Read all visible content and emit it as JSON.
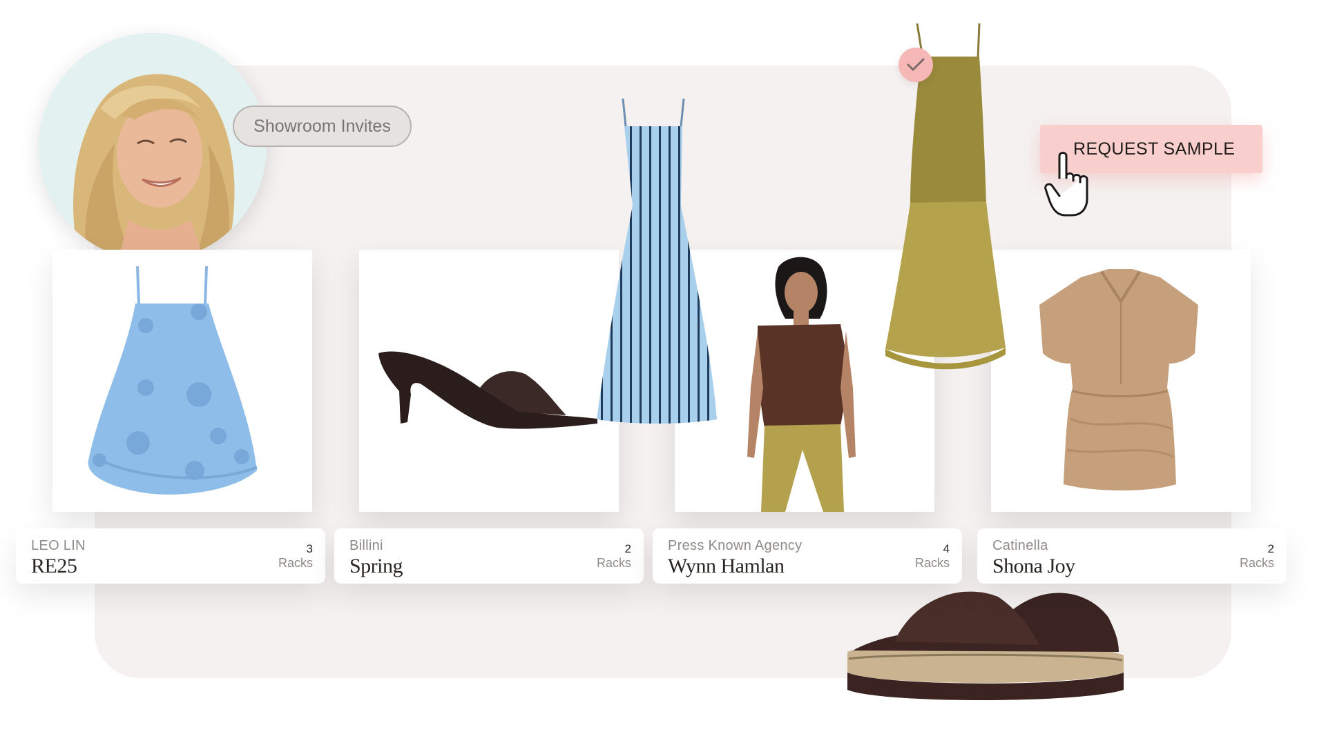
{
  "pill": {
    "label": "Showroom Invites"
  },
  "request": {
    "label": "REQUEST SAMPLE"
  },
  "cards": [
    {
      "brand": "LEO LIN",
      "collection": "RE25",
      "count": "3",
      "unit": "Racks"
    },
    {
      "brand": "Billini",
      "collection": "Spring",
      "count": "2",
      "unit": "Racks"
    },
    {
      "brand": "Press Known Agency",
      "collection": "Wynn Hamlan",
      "count": "4",
      "unit": "Racks"
    },
    {
      "brand": "Catinella",
      "collection": "Shona Joy",
      "count": "2",
      "unit": "Racks"
    }
  ],
  "colors": {
    "panel": "#f4f1f0",
    "accent_pink": "#f9cfcd",
    "check_pink": "#f6b8b6",
    "text_dark": "#2a2522",
    "text_muted": "#8f8a87"
  },
  "icons": [
    "check-icon",
    "pointer-hand-icon"
  ]
}
